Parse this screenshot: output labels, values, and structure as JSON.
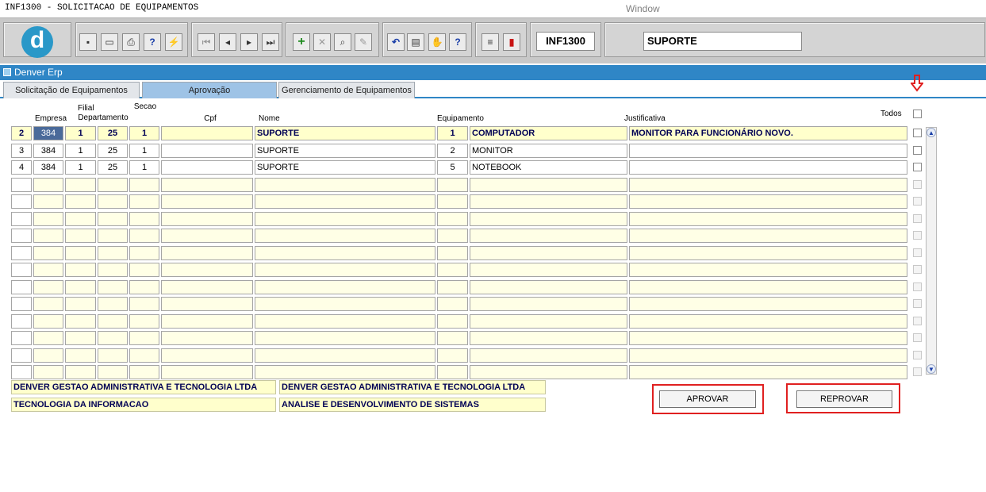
{
  "window": {
    "form_title": "INF1300 - SOLICITACAO DE EQUIPAMENTOS",
    "window_label": "Window"
  },
  "toolbar": {
    "form_code": "INF1300",
    "context": "SUPORTE",
    "buttons": [
      {
        "icon": "save-icon",
        "glyph": "▪"
      },
      {
        "icon": "screen-icon",
        "glyph": "▭"
      },
      {
        "icon": "print-icon",
        "glyph": "⎙"
      },
      {
        "icon": "query-icon",
        "glyph": "?"
      },
      {
        "icon": "execute-query-icon",
        "glyph": "⚡"
      },
      {
        "icon": "first-record-icon",
        "glyph": "⏮"
      },
      {
        "icon": "previous-record-icon",
        "glyph": "◂"
      },
      {
        "icon": "next-record-icon",
        "glyph": "▸"
      },
      {
        "icon": "last-record-icon",
        "glyph": "⏭"
      },
      {
        "icon": "insert-record-icon",
        "glyph": "+"
      },
      {
        "icon": "delete-record-icon",
        "glyph": "✕"
      },
      {
        "icon": "search-record-icon",
        "glyph": "⌕"
      },
      {
        "icon": "clear-icon",
        "glyph": "✎"
      },
      {
        "icon": "undo-icon",
        "glyph": "↶"
      },
      {
        "icon": "clipboard-icon",
        "glyph": "▤"
      },
      {
        "icon": "tools-icon",
        "glyph": "✋"
      },
      {
        "icon": "help-icon",
        "glyph": "?"
      },
      {
        "icon": "menu-icon",
        "glyph": "≡"
      },
      {
        "icon": "exit-icon",
        "glyph": "▮"
      }
    ]
  },
  "app": {
    "title": "Denver Erp"
  },
  "tabs": [
    {
      "label": "Solicitação de Equipamentos",
      "active": false
    },
    {
      "label": "Aprovação",
      "active": true
    },
    {
      "label": "Gerenciamento de Equipamentos",
      "active": false
    }
  ],
  "columns": {
    "empresa": "Empresa",
    "filial": "Filial",
    "departamento": "Departamento",
    "secao": "Secao",
    "cpf": "Cpf",
    "nome": "Nome",
    "equipamento": "Equipamento",
    "justificativa": "Justificativa",
    "todos": "Todos"
  },
  "rows": [
    {
      "seq": "2",
      "empresa": "384",
      "filial": "1",
      "departamento": "25",
      "secao": "1",
      "cpf": "",
      "nome": "SUPORTE",
      "equip_code": "1",
      "equip_name": "COMPUTADOR",
      "justificativa": "MONITOR PARA FUNCIONÁRIO NOVO.",
      "selected": true
    },
    {
      "seq": "3",
      "empresa": "384",
      "filial": "1",
      "departamento": "25",
      "secao": "1",
      "cpf": "",
      "nome": "SUPORTE",
      "equip_code": "2",
      "equip_name": "MONITOR",
      "justificativa": "",
      "selected": false
    },
    {
      "seq": "4",
      "empresa": "384",
      "filial": "1",
      "departamento": "25",
      "secao": "1",
      "cpf": "",
      "nome": "SUPORTE",
      "equip_code": "5",
      "equip_name": "NOTEBOOK",
      "justificativa": "",
      "selected": false
    }
  ],
  "info": {
    "empresa_nome_1": "DENVER GESTAO ADMINISTRATIVA E TECNOLOGIA LTDA",
    "empresa_nome_2": "DENVER GESTAO ADMINISTRATIVA E TECNOLOGIA LTDA",
    "departamento_nome": "TECNOLOGIA DA INFORMACAO",
    "secao_nome": "ANALISE E DESENVOLVIMENTO DE SISTEMAS"
  },
  "actions": {
    "approve": "APROVAR",
    "reject": "REPROVAR"
  },
  "colors": {
    "accent_bar": "#2f86c6",
    "highlight_field": "#ffffcc",
    "annotation_red": "#e02020"
  }
}
